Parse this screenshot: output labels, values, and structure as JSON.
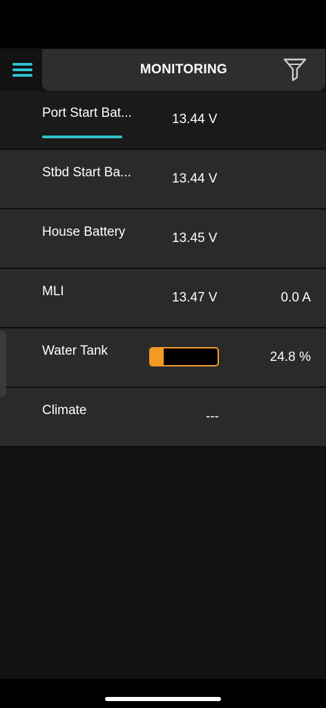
{
  "header": {
    "title": "MONITORING",
    "menu_icon": "hamburger-menu-icon",
    "filter_icon": "filter-funnel-icon"
  },
  "rows": [
    {
      "label": "Port Start Bat...",
      "value": "13.44 V",
      "selected": true
    },
    {
      "label": "Stbd Start Ba...",
      "value": "13.44 V"
    },
    {
      "label": "House Battery",
      "value": "13.45 V"
    },
    {
      "label": "MLI",
      "value": "13.47 V",
      "value_right": "0.0 A"
    },
    {
      "label": "Water Tank",
      "level_fraction": 0.2,
      "value_right": "24.8 %"
    },
    {
      "label": "Climate",
      "value": "---"
    }
  ],
  "colors": {
    "accent": "#2fc3cf",
    "tank": "#f39c24",
    "background": "#121212",
    "row": "#2a2a2a",
    "header": "#2e2e2e"
  }
}
